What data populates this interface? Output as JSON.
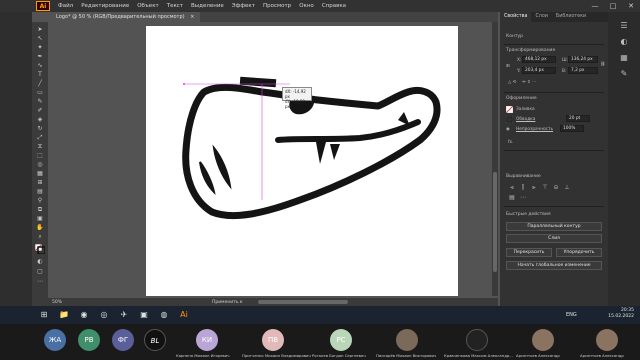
{
  "app": {
    "logo": "Ai",
    "menus": [
      "Файл",
      "Редактирование",
      "Объект",
      "Текст",
      "Выделение",
      "Эффект",
      "Просмотр",
      "Окно",
      "Справка"
    ],
    "window_controls": [
      "—",
      "□",
      "✕"
    ]
  },
  "document": {
    "tab_title": "Logo* @ 50 % (RGB/Предварительный просмотр)",
    "close_label": "×"
  },
  "tooltip": {
    "dx": "dX: -14,92 px",
    "dy": "dY: -10,89 px"
  },
  "status": {
    "zoom": "50%",
    "mode": "Применить к"
  },
  "panel": {
    "tabs": [
      "Свойства",
      "Слои",
      "Библиотеки"
    ],
    "section_contour": "Контур",
    "section_transform": "Трансформирование",
    "x": "468,12 px",
    "w": "136,24 px",
    "y": "203,4 px",
    "h": "7,2 px",
    "section_appearance": "Оформление",
    "fill_label": "Заливка",
    "stroke_label": "Обводка",
    "stroke_value": "20 pt",
    "opacity_label": "Непрозрачность",
    "opacity_value": "100%",
    "fx_label": "fx.",
    "section_align": "Выравнивание",
    "section_quick": "Быстрые действия",
    "btn_offset": "Параллельный контур",
    "btn_join": "Слия",
    "btn_recolor": "Перекрасить",
    "btn_arrange": "Упорядочить",
    "btn_global": "Начать глобальное изменение"
  },
  "taskbar": {
    "time": "20:35",
    "date": "15.02.2022",
    "lang": "ENG"
  },
  "participants": [
    {
      "initials": "ЖА",
      "color": "#4a6fa5",
      "name": ""
    },
    {
      "initials": "РВ",
      "color": "#3f8f6b",
      "name": ""
    },
    {
      "initials": "ФГ",
      "color": "#5a5f9a",
      "name": ""
    },
    {
      "initials": "BL",
      "color": "#111111",
      "name": ""
    },
    {
      "initials": "КИ",
      "color": "#b9a6d6",
      "name": "Карпеня Михаил Игоревич"
    },
    {
      "initials": "ПВ",
      "color": "#e2b9b9",
      "name": "Притченко Михаил Владимирович"
    },
    {
      "initials": "РС",
      "color": "#b9d6b9",
      "name": "Рогалев Богдан Сергеевич"
    },
    {
      "initials": "",
      "color": "#7b6a5a",
      "name": "Пискарёв Михаил Викторович"
    },
    {
      "initials": "",
      "color": "#222222",
      "name": "Кравченкова Максим Александр..."
    },
    {
      "initials": "",
      "color": "#8a7360",
      "name": "Арсентьев Александр"
    },
    {
      "initials": "",
      "color": "#8a7360",
      "name": "Арсентьев Александр"
    }
  ]
}
